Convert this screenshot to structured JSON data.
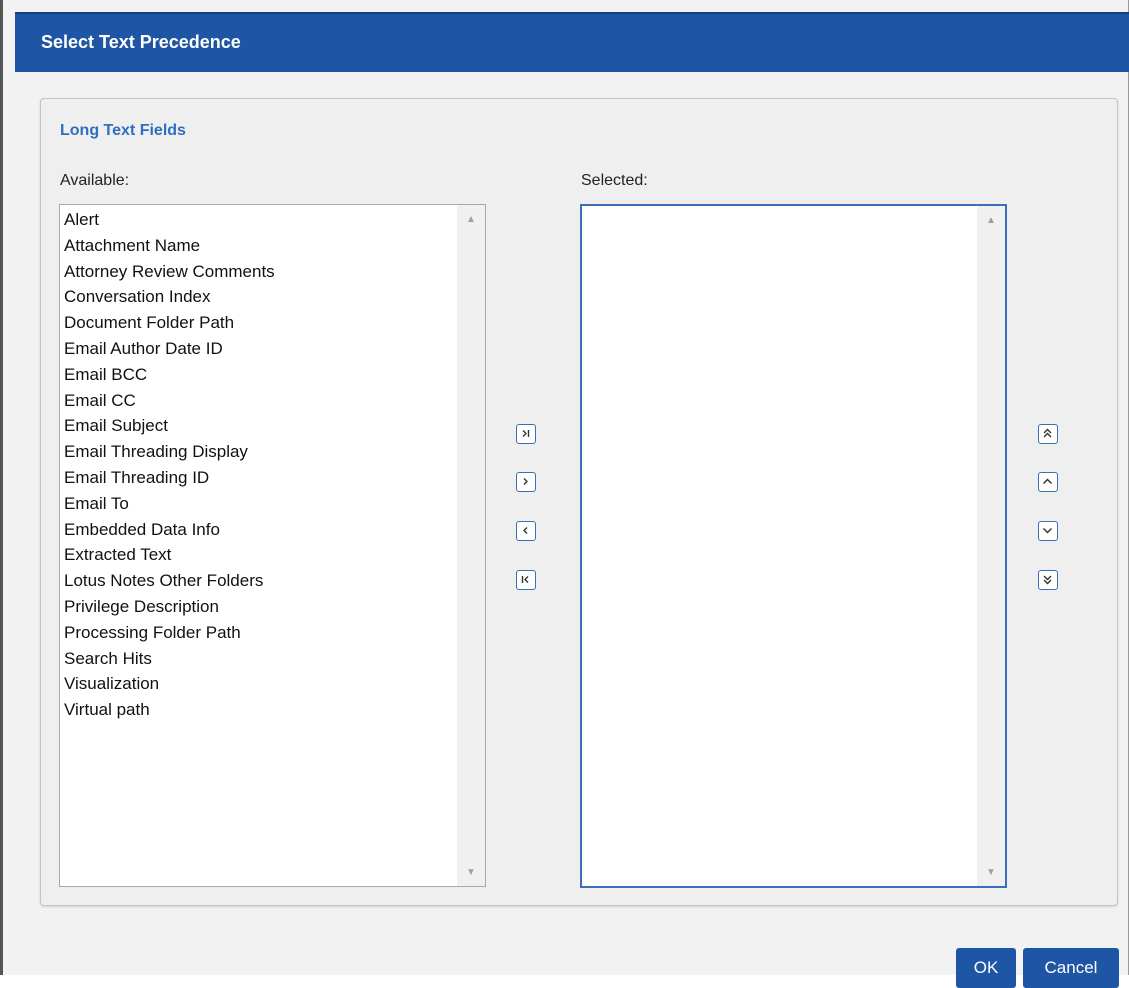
{
  "dialog": {
    "title": "Select Text Precedence"
  },
  "section": {
    "title": "Long Text Fields"
  },
  "available": {
    "label": "Available:",
    "items": [
      "Alert",
      "Attachment Name",
      "Attorney Review Comments",
      "Conversation Index",
      "Document Folder Path",
      "Email Author Date ID",
      "Email BCC",
      "Email CC",
      "Email Subject",
      "Email Threading Display",
      "Email Threading ID",
      "Email To",
      "Embedded Data Info",
      "Extracted Text",
      "Lotus Notes Other Folders",
      "Privilege Description",
      "Processing Folder Path",
      "Search Hits",
      "Visualization",
      "Virtual path"
    ]
  },
  "selected": {
    "label": "Selected:",
    "items": []
  },
  "transfer_buttons": [
    {
      "name": "move-all-right-button",
      "icon": "move-all-right-icon"
    },
    {
      "name": "move-right-button",
      "icon": "chevron-right-icon"
    },
    {
      "name": "move-left-button",
      "icon": "chevron-left-icon"
    },
    {
      "name": "move-all-left-button",
      "icon": "move-all-left-icon"
    }
  ],
  "order_buttons": [
    {
      "name": "move-to-top-button",
      "icon": "double-chevron-up-icon"
    },
    {
      "name": "move-up-button",
      "icon": "chevron-up-icon"
    },
    {
      "name": "move-down-button",
      "icon": "chevron-down-icon"
    },
    {
      "name": "move-to-bottom-button",
      "icon": "double-chevron-down-icon"
    }
  ],
  "footer": {
    "ok_label": "OK",
    "cancel_label": "Cancel"
  },
  "colors": {
    "title_bar": "#1e56a5",
    "section_title": "#2f6fbe",
    "button_fill": "#1e56a5",
    "icon_button_border": "#3a6fb0"
  }
}
